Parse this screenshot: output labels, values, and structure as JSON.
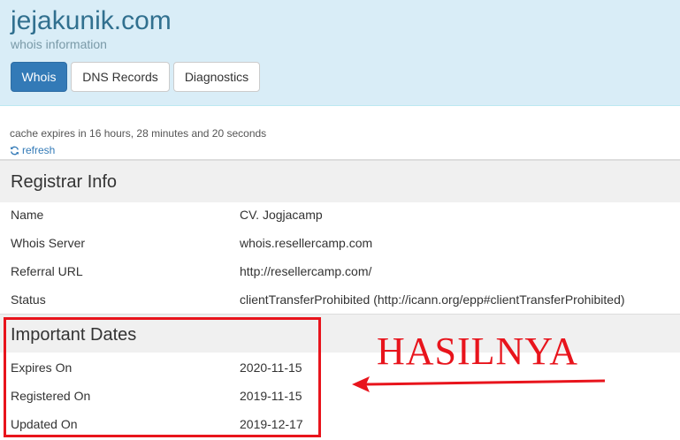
{
  "header": {
    "title": "jejakunik.com",
    "subtitle": "whois information",
    "tabs": [
      {
        "label": "Whois",
        "active": true
      },
      {
        "label": "DNS Records",
        "active": false
      },
      {
        "label": "Diagnostics",
        "active": false
      }
    ]
  },
  "cache": {
    "text": "cache expires in 16 hours, 28 minutes and 20 seconds",
    "refresh_label": "refresh",
    "refresh_icon": "refresh-icon"
  },
  "registrar": {
    "heading": "Registrar Info",
    "rows": [
      {
        "key": "Name",
        "value": "CV. Jogjacamp"
      },
      {
        "key": "Whois Server",
        "value": "whois.resellercamp.com"
      },
      {
        "key": "Referral URL",
        "value": "http://resellercamp.com/"
      },
      {
        "key": "Status",
        "value": "clientTransferProhibited (http://icann.org/epp#clientTransferProhibited)"
      }
    ]
  },
  "dates": {
    "heading": "Important Dates",
    "rows": [
      {
        "key": "Expires On",
        "value": "2020-11-15"
      },
      {
        "key": "Registered On",
        "value": "2019-11-15"
      },
      {
        "key": "Updated On",
        "value": "2019-12-17"
      }
    ]
  },
  "annotation": {
    "text": "HASILNYA",
    "color": "#e8141c"
  },
  "colors": {
    "header_bg": "#d9edf7",
    "title": "#31708f",
    "active_tab": "#337ab7",
    "link": "#337ab7"
  }
}
